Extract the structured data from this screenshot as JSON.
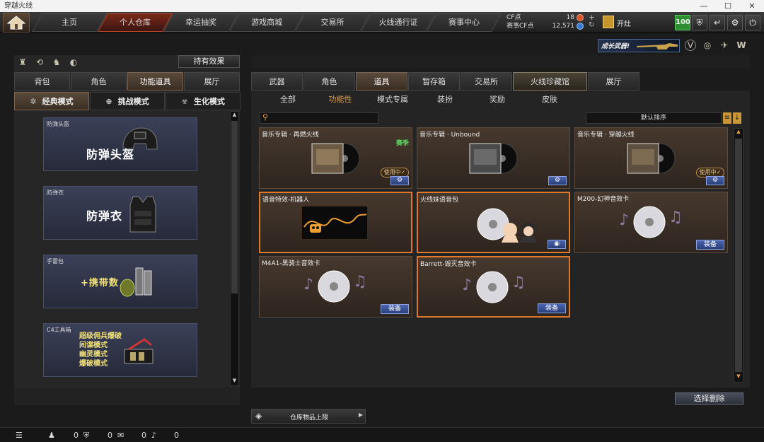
{
  "window": {
    "title": "穿越火线",
    "min": "—",
    "max": "☐",
    "close": "✕"
  },
  "nav": {
    "tabs": [
      {
        "label": "主页",
        "active": false
      },
      {
        "label": "个人仓库",
        "active": true
      },
      {
        "label": "幸运抽奖",
        "active": false
      },
      {
        "label": "游戏商城",
        "active": false
      },
      {
        "label": "交易所",
        "active": false
      },
      {
        "label": "火线通行证",
        "active": false
      },
      {
        "label": "赛事中心",
        "active": false
      }
    ]
  },
  "currency": {
    "cf_label": "CF点",
    "cf_value": "18",
    "match_label": "赛事CF点",
    "match_value": "12,571"
  },
  "user": {
    "name": "开灶",
    "level": "100"
  },
  "left": {
    "effects_button": "持有效果",
    "tabs": [
      {
        "label": "背包",
        "active": false
      },
      {
        "label": "角色",
        "active": false
      },
      {
        "label": "功能道具",
        "active": true
      },
      {
        "label": "展厅",
        "active": false
      }
    ],
    "modes": [
      {
        "label": "经典模式",
        "icon": "crosshair-icon",
        "active": true
      },
      {
        "label": "挑战模式",
        "icon": "target-icon",
        "active": false
      },
      {
        "label": "生化模式",
        "icon": "biohazard-icon",
        "active": false
      }
    ],
    "cards": [
      {
        "category": "防弹头盔",
        "title": "防弹头盔"
      },
      {
        "category": "防弹衣",
        "title": "防弹衣"
      },
      {
        "category": "手雷包",
        "title": "+携带数"
      },
      {
        "category": "C4工具箱",
        "lines": [
          "超级佣兵爆破",
          "间谍模式",
          "幽灵模式",
          "爆破模式"
        ]
      }
    ]
  },
  "right": {
    "banner": "成长武器!",
    "tabs": [
      {
        "label": "武器",
        "active": false
      },
      {
        "label": "角色",
        "active": false
      },
      {
        "label": "道具",
        "active": true
      },
      {
        "label": "暂存箱",
        "active": false
      },
      {
        "label": "交易所",
        "active": false
      },
      {
        "label": "火线珍藏馆",
        "active": false
      },
      {
        "label": "展厅",
        "active": false
      }
    ],
    "subtabs": [
      {
        "label": "全部",
        "active": false
      },
      {
        "label": "功能性",
        "active": true
      },
      {
        "label": "模式专属",
        "active": false
      },
      {
        "label": "装扮",
        "active": false
      },
      {
        "label": "奖励",
        "active": false
      },
      {
        "label": "皮肤",
        "active": false
      }
    ],
    "sort_label": "默认排序",
    "items": [
      {
        "name": "音乐专辑 · 再燃火线",
        "tag": "赛季",
        "using": "使用中✓"
      },
      {
        "name": "音乐专辑 · Unbound"
      },
      {
        "name": "音乐专辑 · 穿越火线",
        "using": "使用中✓"
      },
      {
        "name": "语音特效-机器人"
      },
      {
        "name": "火线妹语音包"
      },
      {
        "name": "M200-幻神音效卡",
        "equip": "装备"
      },
      {
        "name": "M4A1-黑骑士音效卡",
        "equip": "装备"
      },
      {
        "name": "Barrett-毁灭音效卡",
        "equip": "装备"
      }
    ],
    "delete_button": "选择删除",
    "capacity_label": "仓库物品上限"
  },
  "bottom": {
    "counts": [
      "0",
      "0",
      "0",
      "0"
    ]
  }
}
